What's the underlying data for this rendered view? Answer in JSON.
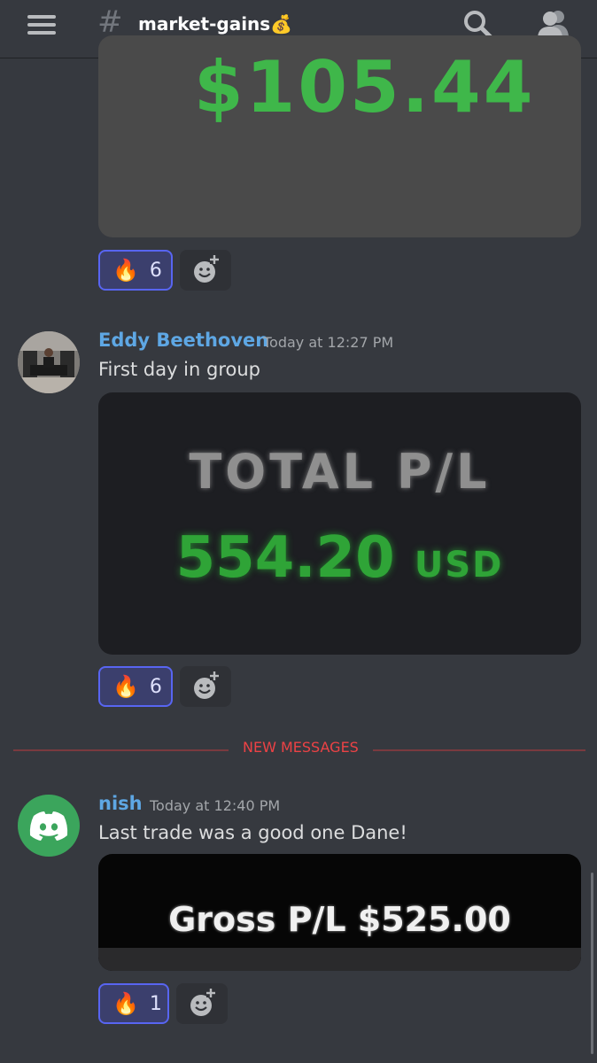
{
  "header": {
    "channel_hash": "#",
    "channel_name": "market-gains💰"
  },
  "messages": [
    {
      "image_text": "$105.44",
      "reactions": [
        {
          "emoji": "🔥",
          "count": "6"
        }
      ]
    },
    {
      "author": "Eddy Beethoven",
      "timestamp": "Today at 12:27 PM",
      "text": "First day in group",
      "image_text_line1": "TOTAL P/L",
      "image_text_value": "554.20",
      "image_text_unit": "USD",
      "reactions": [
        {
          "emoji": "🔥",
          "count": "6"
        }
      ]
    },
    {
      "author": "nish",
      "timestamp": "Today at 12:40 PM",
      "text": "Last trade was a good one Dane!",
      "image_text": "Gross P/L  $525.00",
      "reactions": [
        {
          "emoji": "🔥",
          "count": "1"
        }
      ]
    }
  ],
  "divider": {
    "label": "NEW MESSAGES"
  },
  "colors": {
    "background": "#36393f",
    "username": "#5ea7e4",
    "reaction_active_border": "#5865f2",
    "new_messages": "#ed4245",
    "discord_avatar": "#3ba55c",
    "gain_green": "#3ec14a"
  },
  "icons": {
    "menu": "hamburger-menu-icon",
    "search": "search-icon",
    "members": "members-icon",
    "add_reaction": "add-reaction-icon"
  }
}
